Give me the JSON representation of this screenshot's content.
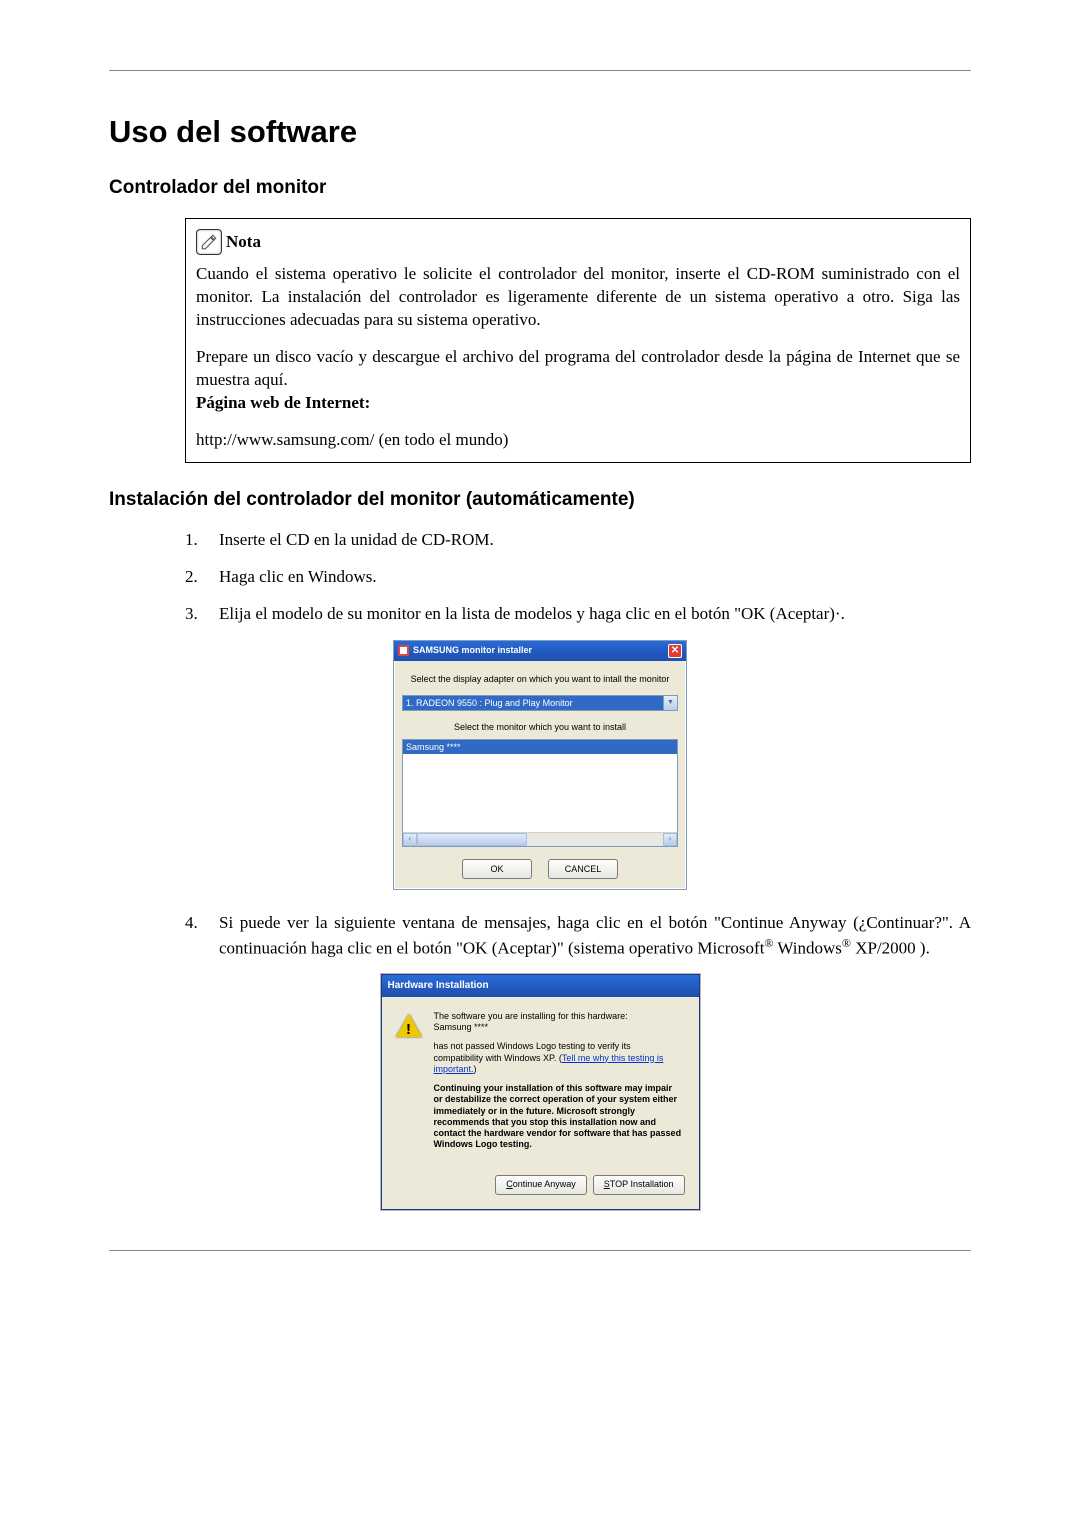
{
  "doc": {
    "title": "Uso del software",
    "section1": "Controlador del monitor",
    "note": {
      "label": "Nota",
      "para1": "Cuando el sistema operativo le solicite el controlador del monitor, inserte el CD-ROM suministrado con el monitor. La instalación del controlador es ligeramente diferente de un sistema operativo a otro. Siga las instrucciones adecuadas para su sistema operativo.",
      "para2": "Prepare un disco vacío y descargue el archivo del programa del controlador desde la página de Internet que se muestra aquí.",
      "urllabel": "Página web de Internet:",
      "url": "http://www.samsung.com/ (en todo el mundo)"
    },
    "section2": "Instalación del controlador del monitor (automáticamente)",
    "steps": {
      "s1num": "1.",
      "s1": "Inserte el CD en la unidad de CD-ROM.",
      "s2num": "2.",
      "s2": "Haga clic en Windows.",
      "s3num": "3.",
      "s3": "Elija el modelo de su monitor en la lista de modelos y haga clic en el botón \"OK (Aceptar)·.",
      "s4num": "4.",
      "s4a": "Si puede ver la siguiente ventana de mensajes, haga clic en el botón \"Continue Anyway (¿Continuar?\". A continuación haga clic en el botón \"OK (Aceptar)\" (sistema operativo Microsoft",
      "s4b": " Windows",
      "s4c": " XP/2000 )."
    }
  },
  "installer": {
    "title": "SAMSUNG monitor installer",
    "instr1": "Select the display adapter on which you want to intall the monitor",
    "adapter": "1. RADEON 9550 : Plug and Play Monitor",
    "instr2": "Select the monitor which you want to install",
    "model": "Samsung ****",
    "ok": "OK",
    "cancel": "CANCEL"
  },
  "hw": {
    "title": "Hardware Installation",
    "p1": "The software you are installing for this hardware:",
    "p2": "Samsung ****",
    "p3a": "has not passed Windows Logo testing to verify its compatibility with Windows XP. (",
    "p3link": "Tell me why this testing is important.",
    "p3b": ")",
    "p4": "Continuing your installation of this software may impair or destabilize the correct operation of your system either immediately or in the future. Microsoft strongly recommends that you stop this installation now and contact the hardware vendor for software that has passed Windows Logo testing.",
    "btn_continue_pre": "C",
    "btn_continue_rest": "ontinue Anyway",
    "btn_stop_pre": "S",
    "btn_stop_rest": "TOP Installation"
  }
}
